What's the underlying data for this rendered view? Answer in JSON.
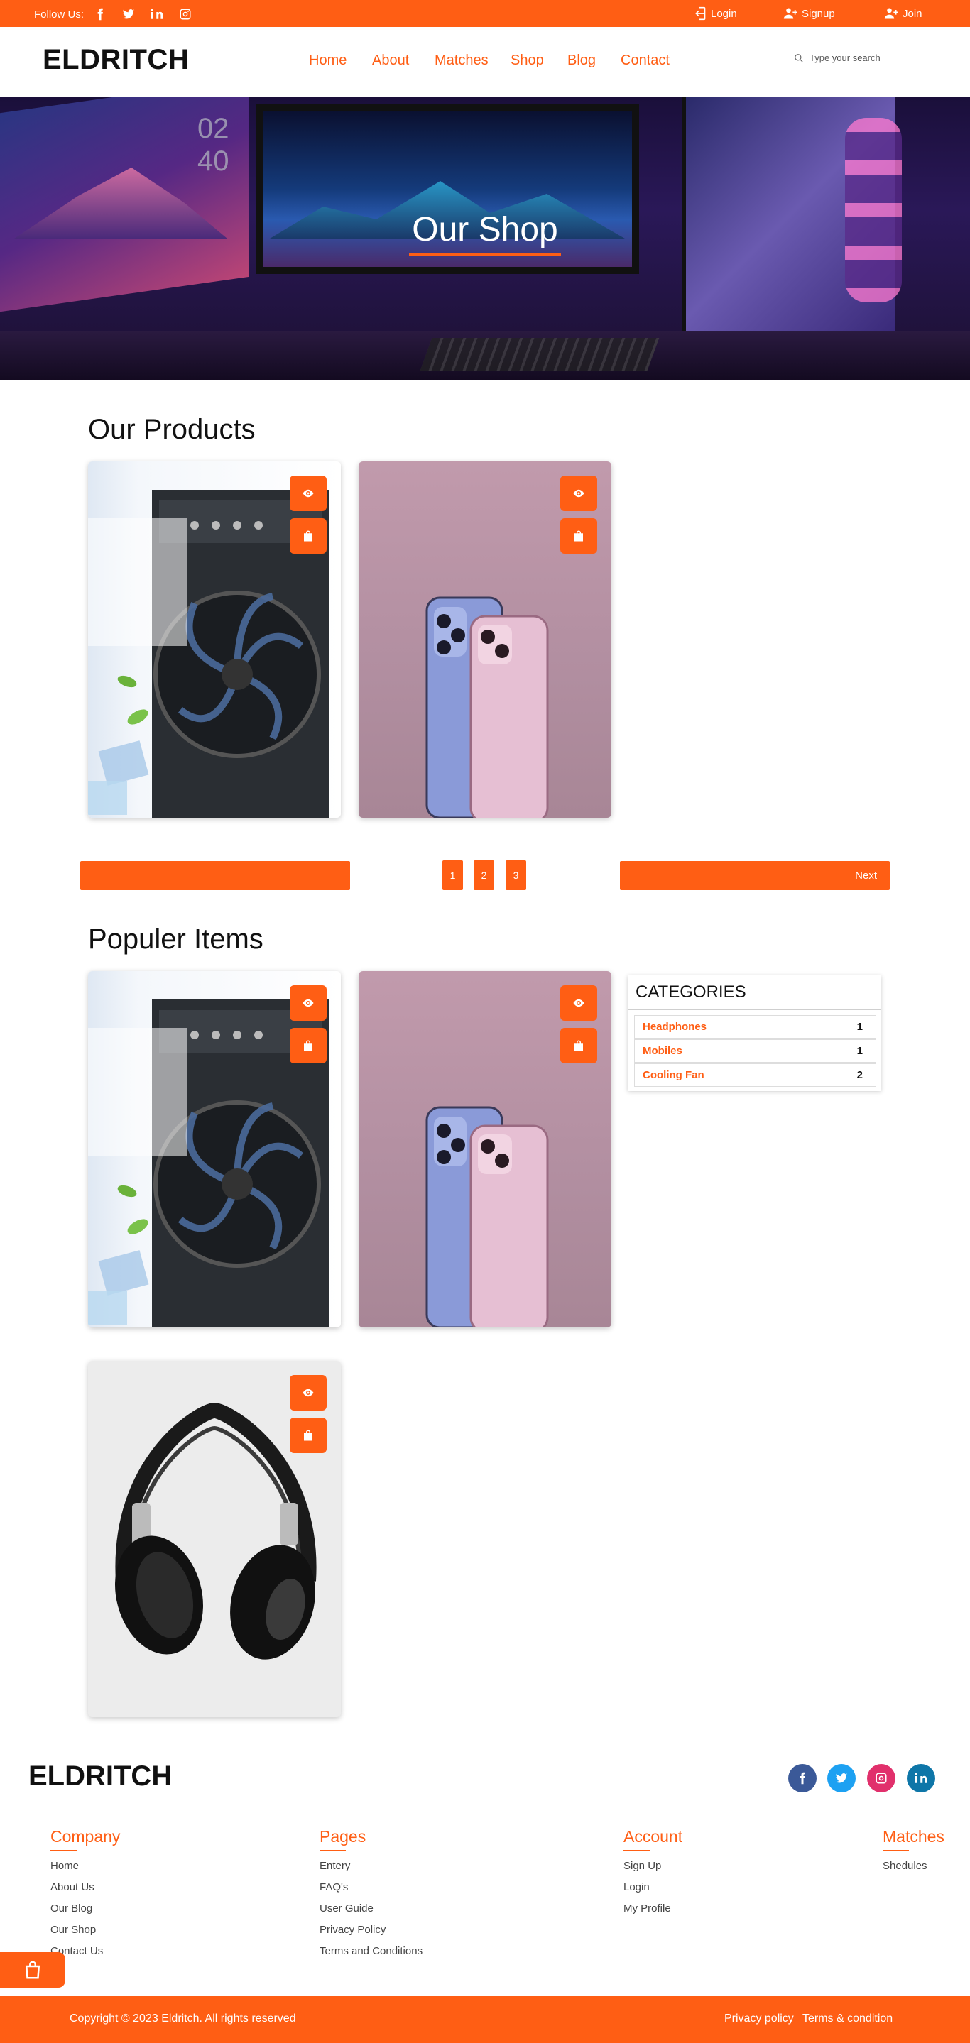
{
  "topbar": {
    "follow_label": "Follow Us:",
    "socials": [
      "facebook-icon",
      "twitter-icon",
      "linkedin-icon",
      "instagram-icon"
    ],
    "login": "Login",
    "signup": "Signup",
    "join": "Join"
  },
  "header": {
    "logo": "ELDRITCH",
    "nav": [
      "Home",
      "About",
      "Matches",
      "Shop",
      "Blog",
      "Contact"
    ],
    "search_placeholder": "Type your search"
  },
  "hero": {
    "title": "Our Shop",
    "clock": [
      "02",
      "40"
    ]
  },
  "products": {
    "title": "Our Products",
    "items": [
      {
        "image": "cooling-fan",
        "actions": [
          "eye-icon",
          "bag-icon"
        ]
      },
      {
        "image": "mobile-phones",
        "actions": [
          "eye-icon",
          "bag-icon"
        ]
      }
    ]
  },
  "pagination": {
    "pages": [
      "1",
      "2",
      "3"
    ],
    "next": "Next"
  },
  "popular": {
    "title": "Populer Items",
    "items": [
      {
        "image": "cooling-fan"
      },
      {
        "image": "mobile-phones"
      },
      {
        "image": "headphones"
      }
    ]
  },
  "categories": {
    "title": "CATEGORIES",
    "items": [
      {
        "name": "Headphones",
        "count": "1"
      },
      {
        "name": "Mobiles",
        "count": "1"
      },
      {
        "name": "Cooling Fan",
        "count": "2"
      }
    ]
  },
  "footer": {
    "logo": "ELDRITCH",
    "columns": [
      {
        "title": "Company",
        "links": [
          "Home",
          "About Us",
          "Our Blog",
          "Our Shop",
          "Contact Us"
        ]
      },
      {
        "title": "Pages",
        "links": [
          "Entery",
          "FAQ's",
          "User Guide",
          "Privacy Policy",
          "Terms and Conditions"
        ]
      },
      {
        "title": "Account",
        "links": [
          "Sign Up",
          "Login",
          "My Profile"
        ]
      },
      {
        "title": "Matches",
        "links": [
          "Shedules"
        ]
      }
    ],
    "copyright": "Copyright © 2023 Eldritch.  All rights reserved",
    "privacy": "Privacy policy",
    "terms": "Terms & condition"
  },
  "colors": {
    "accent": "#ff5e14",
    "facebook": "#3b5998",
    "twitter": "#1da1f2",
    "instagram": "#e1306c",
    "linkedin": "#0e76a8"
  }
}
